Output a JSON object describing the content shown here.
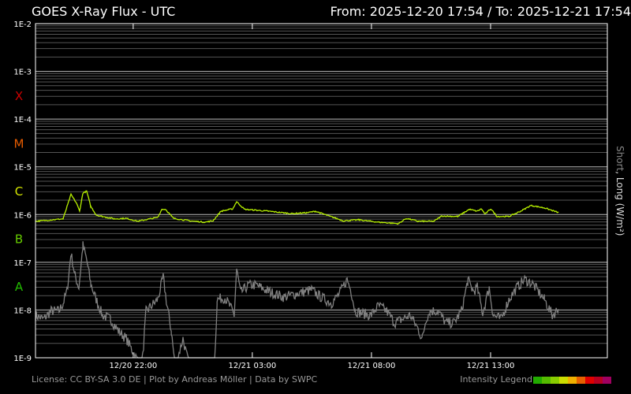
{
  "chart_data": {
    "type": "line",
    "title": "GOES X-Ray Flux - UTC",
    "range_label": "From: 2025-12-20 17:54  /  To: 2025-12-21 17:54",
    "ylabel_short": "Short",
    "ylabel_rest": ", Long (W/m²)",
    "y_scale": "log",
    "ylim_log10": [
      -9,
      -2
    ],
    "ytick_labels": [
      "1E-2",
      "1E-3",
      "1E-4",
      "1E-5",
      "1E-6",
      "1E-7",
      "1E-8",
      "1E-9"
    ],
    "x_unit": "hours since 2025-12-20 17:54 UTC",
    "xlim": [
      0,
      24
    ],
    "xticks": [
      {
        "h": 4.1,
        "label": "12/20 22:00"
      },
      {
        "h": 9.1,
        "label": "12/21 03:00"
      },
      {
        "h": 14.1,
        "label": "12/21 08:00"
      },
      {
        "h": 19.1,
        "label": "12/21 13:00"
      }
    ],
    "flare_classes": [
      {
        "label": "X",
        "color": "#cc0000"
      },
      {
        "label": "M",
        "color": "#e65c00"
      },
      {
        "label": "C",
        "color": "#d4e600"
      },
      {
        "label": "B",
        "color": "#66cc00"
      },
      {
        "label": "A",
        "color": "#22bb00"
      }
    ],
    "series": [
      {
        "name": "Long",
        "color": "#b7f000",
        "points_h_log10": [
          [
            0,
            -6.14
          ],
          [
            1.16,
            -6.09
          ],
          [
            1.49,
            -5.58
          ],
          [
            1.72,
            -5.76
          ],
          [
            1.85,
            -5.93
          ],
          [
            1.99,
            -5.55
          ],
          [
            2.15,
            -5.51
          ],
          [
            2.32,
            -5.83
          ],
          [
            2.55,
            -6.01
          ],
          [
            2.81,
            -6.04
          ],
          [
            3.31,
            -6.09
          ],
          [
            3.81,
            -6.08
          ],
          [
            4.3,
            -6.14
          ],
          [
            4.8,
            -6.09
          ],
          [
            5.13,
            -6.06
          ],
          [
            5.3,
            -5.89
          ],
          [
            5.46,
            -5.89
          ],
          [
            5.79,
            -6.08
          ],
          [
            6.46,
            -6.13
          ],
          [
            7.12,
            -6.16
          ],
          [
            7.45,
            -6.13
          ],
          [
            7.78,
            -5.93
          ],
          [
            8.28,
            -5.88
          ],
          [
            8.44,
            -5.73
          ],
          [
            8.77,
            -5.89
          ],
          [
            9.77,
            -5.93
          ],
          [
            10.76,
            -5.98
          ],
          [
            11.42,
            -5.96
          ],
          [
            11.75,
            -5.93
          ],
          [
            12.09,
            -5.99
          ],
          [
            12.91,
            -6.13
          ],
          [
            13.58,
            -6.11
          ],
          [
            14.4,
            -6.16
          ],
          [
            15.23,
            -6.19
          ],
          [
            15.56,
            -6.08
          ],
          [
            16.06,
            -6.14
          ],
          [
            16.72,
            -6.14
          ],
          [
            17.05,
            -6.03
          ],
          [
            17.72,
            -6.04
          ],
          [
            18.21,
            -5.89
          ],
          [
            18.54,
            -5.93
          ],
          [
            18.71,
            -5.88
          ],
          [
            18.87,
            -5.99
          ],
          [
            19.11,
            -5.88
          ],
          [
            19.37,
            -6.04
          ],
          [
            19.87,
            -6.04
          ],
          [
            20.36,
            -5.93
          ],
          [
            20.79,
            -5.81
          ],
          [
            21.36,
            -5.86
          ],
          [
            21.95,
            -5.96
          ]
        ]
      },
      {
        "name": "Short",
        "color": "#808080",
        "points_h_log10": [
          [
            0,
            -8.11
          ],
          [
            0.33,
            -8.19
          ],
          [
            0.66,
            -8.02
          ],
          [
            0.99,
            -8.02
          ],
          [
            1.16,
            -7.86
          ],
          [
            1.32,
            -7.61
          ],
          [
            1.49,
            -6.82
          ],
          [
            1.66,
            -7.28
          ],
          [
            1.82,
            -7.53
          ],
          [
            1.99,
            -6.65
          ],
          [
            2.15,
            -6.95
          ],
          [
            2.32,
            -7.45
          ],
          [
            2.48,
            -7.69
          ],
          [
            2.81,
            -8.11
          ],
          [
            3.15,
            -8.19
          ],
          [
            3.48,
            -8.44
          ],
          [
            3.81,
            -8.6
          ],
          [
            4.14,
            -8.93
          ],
          [
            4.47,
            -9.2
          ],
          [
            4.64,
            -8.02
          ],
          [
            4.97,
            -7.86
          ],
          [
            5.13,
            -7.78
          ],
          [
            5.36,
            -7.31
          ],
          [
            5.53,
            -7.94
          ],
          [
            5.7,
            -8.44
          ],
          [
            5.86,
            -9.2
          ],
          [
            6.19,
            -8.6
          ],
          [
            6.46,
            -9.2
          ],
          [
            7.52,
            -9.2
          ],
          [
            7.62,
            -7.78
          ],
          [
            7.95,
            -7.74
          ],
          [
            8.18,
            -7.94
          ],
          [
            8.34,
            -8.11
          ],
          [
            8.44,
            -7.15
          ],
          [
            8.61,
            -7.64
          ],
          [
            8.94,
            -7.48
          ],
          [
            9.27,
            -7.48
          ],
          [
            9.77,
            -7.61
          ],
          [
            10.43,
            -7.73
          ],
          [
            11.09,
            -7.64
          ],
          [
            11.59,
            -7.58
          ],
          [
            11.92,
            -7.71
          ],
          [
            12.42,
            -7.86
          ],
          [
            12.75,
            -7.66
          ],
          [
            13.08,
            -7.36
          ],
          [
            13.25,
            -7.61
          ],
          [
            13.41,
            -8.02
          ],
          [
            13.74,
            -8.07
          ],
          [
            14.07,
            -8.11
          ],
          [
            14.4,
            -7.91
          ],
          [
            14.74,
            -8.02
          ],
          [
            15.07,
            -8.27
          ],
          [
            15.4,
            -8.19
          ],
          [
            15.73,
            -8.11
          ],
          [
            16.06,
            -8.4
          ],
          [
            16.23,
            -8.6
          ],
          [
            16.39,
            -8.19
          ],
          [
            16.56,
            -8.02
          ],
          [
            16.89,
            -8.02
          ],
          [
            17.22,
            -8.27
          ],
          [
            17.55,
            -8.27
          ],
          [
            17.88,
            -8.02
          ],
          [
            18.15,
            -7.38
          ],
          [
            18.38,
            -7.61
          ],
          [
            18.54,
            -7.53
          ],
          [
            18.77,
            -8.07
          ],
          [
            19.04,
            -7.53
          ],
          [
            19.21,
            -8.11
          ],
          [
            19.54,
            -8.19
          ],
          [
            19.87,
            -7.78
          ],
          [
            20.2,
            -7.53
          ],
          [
            20.53,
            -7.36
          ],
          [
            20.86,
            -7.45
          ],
          [
            21.36,
            -7.78
          ],
          [
            21.69,
            -8.11
          ],
          [
            21.95,
            -7.98
          ]
        ]
      }
    ],
    "footer": "License: CC BY-SA 3.0 DE | Plot by Andreas Möller | Data by SWPC",
    "intensity_legend_label": "Intensity Legend",
    "intensity_colors": [
      "#22aa00",
      "#55bb00",
      "#88cc00",
      "#ccdd00",
      "#f0b000",
      "#e86000",
      "#e00000",
      "#b80020",
      "#a00060"
    ]
  }
}
